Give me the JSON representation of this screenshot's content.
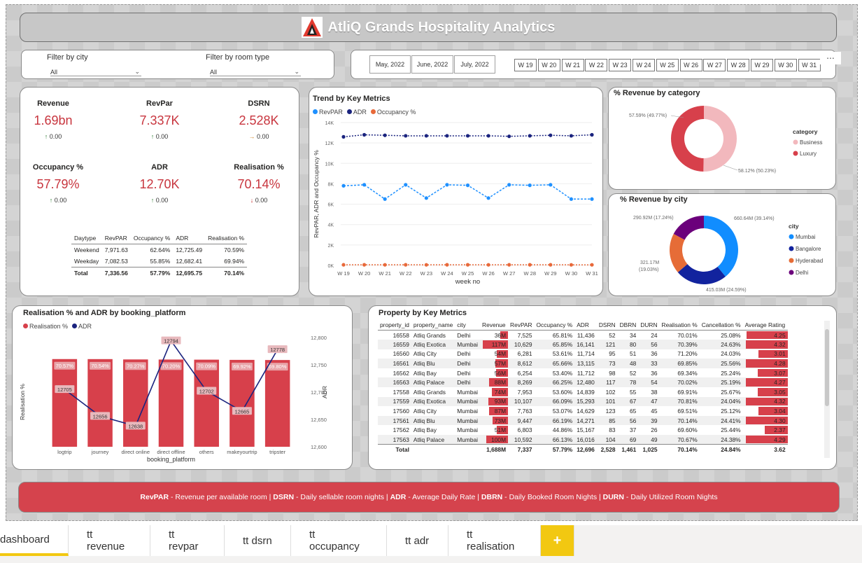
{
  "title": "AtliQ Grands Hospitality Analytics",
  "filters": {
    "city": {
      "label": "Filter by city",
      "value": "All"
    },
    "room_type": {
      "label": "Filter by room type",
      "value": "All"
    },
    "months": [
      "May, 2022",
      "June, 2022",
      "July, 2022"
    ],
    "weeks": [
      "W 19",
      "W 20",
      "W 21",
      "W 22",
      "W 23",
      "W 24",
      "W 25",
      "W 26",
      "W 27",
      "W 28",
      "W 29",
      "W 30",
      "W 31"
    ],
    "more": "..."
  },
  "kpis": [
    {
      "label": "Revenue",
      "value": "1.69bn",
      "change": "0.00",
      "icon": "arrow-up-icon"
    },
    {
      "label": "RevPar",
      "value": "7.337K",
      "change": "0.00",
      "icon": "arrow-up-icon"
    },
    {
      "label": "DSRN",
      "value": "2.528K",
      "change": "0.00",
      "icon": "arrow-right-icon"
    },
    {
      "label": "Occupancy %",
      "value": "57.79%",
      "change": "0.00",
      "icon": "arrow-up-icon"
    },
    {
      "label": "ADR",
      "value": "12.70K",
      "change": "0.00",
      "icon": "arrow-up-icon"
    },
    {
      "label": "Realisation %",
      "value": "70.14%",
      "change": "0.00",
      "icon": "arrow-down-icon"
    }
  ],
  "daytype_table": {
    "headers": [
      "Daytype",
      "RevPAR",
      "Occupancy %",
      "ADR",
      "Realisation %"
    ],
    "rows": [
      [
        "Weekend",
        "7,971.63",
        "62.64%",
        "12,725.49",
        "70.59%"
      ],
      [
        "Weekday",
        "7,082.53",
        "55.85%",
        "12,682.41",
        "69.94%"
      ]
    ],
    "total": [
      "Total",
      "7,336.56",
      "57.79%",
      "12,695.75",
      "70.14%"
    ]
  },
  "chart_data": [
    {
      "type": "line",
      "title": "Trend by Key Metrics",
      "xlabel": "week no",
      "ylabel": "RevPAR, ADR and Occupancy %",
      "x": [
        "W 19",
        "W 20",
        "W 21",
        "W 22",
        "W 23",
        "W 24",
        "W 25",
        "W 26",
        "W 27",
        "W 28",
        "W 29",
        "W 30",
        "W 31"
      ],
      "y_ticks": [
        "0K",
        "2K",
        "4K",
        "6K",
        "8K",
        "10K",
        "12K",
        "14K"
      ],
      "ylim": [
        0,
        14000
      ],
      "series": [
        {
          "name": "RevPAR",
          "color": "#1e90ff",
          "values": [
            7800,
            7900,
            6500,
            7900,
            6600,
            7900,
            7850,
            6600,
            7900,
            7850,
            7900,
            6500,
            6500
          ]
        },
        {
          "name": "ADR",
          "color": "#1a237e",
          "values": [
            12600,
            12800,
            12750,
            12700,
            12700,
            12700,
            12700,
            12700,
            12650,
            12700,
            12750,
            12700,
            12800
          ]
        },
        {
          "name": "Occupancy %",
          "color": "#e8693a",
          "values": [
            58,
            60,
            55,
            60,
            55,
            60,
            59,
            55,
            60,
            59,
            60,
            55,
            55
          ]
        }
      ]
    },
    {
      "type": "pie",
      "title": "% Revenue by category",
      "legend_title": "category",
      "slices": [
        {
          "name": "Business",
          "value": 50.23,
          "color": "#f2b8bd",
          "label": "58.12% (50.23%)"
        },
        {
          "name": "Luxury",
          "value": 49.77,
          "color": "#d7404b",
          "label": "57.59% (49.77%)"
        }
      ]
    },
    {
      "type": "pie",
      "title": "% Revenue by city",
      "legend_title": "city",
      "slices": [
        {
          "name": "Mumbai",
          "value": 39.14,
          "color": "#118dff",
          "label": "660.64M (39.14%)"
        },
        {
          "name": "Bangalore",
          "value": 24.59,
          "color": "#12239e",
          "label": "415.03M (24.59%)"
        },
        {
          "name": "Hyderabad",
          "value": 19.03,
          "color": "#e66c37",
          "label": "321.17M (19.03%)"
        },
        {
          "name": "Delhi",
          "value": 17.24,
          "color": "#6b007b",
          "label": "290.92M (17.24%)"
        }
      ]
    },
    {
      "type": "bar",
      "title": "Realisation % and ADR by booking_platform",
      "xlabel": "booking_platform",
      "ylabel": "Realisation %",
      "y2label": "ADR",
      "categories": [
        "logtrip",
        "journey",
        "direct online",
        "direct offline",
        "others",
        "makeyourtrip",
        "tripster"
      ],
      "y2_ticks": [
        "12,600",
        "12,650",
        "12,700",
        "12,750",
        "12,800"
      ],
      "y2lim": [
        12600,
        12800
      ],
      "series": [
        {
          "name": "Realisation %",
          "color": "#d7404b",
          "values": [
            70.57,
            70.54,
            70.27,
            70.2,
            70.09,
            69.92,
            69.8
          ],
          "labels": [
            "70.57%",
            "70.54%",
            "70.27%",
            "70.20%",
            "70.09%",
            "69.92%",
            "69.80%"
          ]
        },
        {
          "name": "ADR",
          "color": "#1a237e",
          "values": [
            12705,
            12656,
            12638,
            12794,
            12702,
            12665,
            12778
          ],
          "labels": [
            "12705",
            "12656",
            "12638",
            "12794",
            "12702",
            "12665",
            "12778"
          ]
        }
      ]
    }
  ],
  "property_table": {
    "title": "Property by Key Metrics",
    "headers": [
      "property_id",
      "property_name",
      "city",
      "Revenue",
      "RevPAR",
      "Occupancy %",
      "ADR",
      "DSRN",
      "DBRN",
      "DURN",
      "Realisation %",
      "Cancellation %",
      "Average Rating"
    ],
    "rows": [
      [
        "16558",
        "Atliq Grands",
        "Delhi",
        "36M",
        "7,525",
        "65.81%",
        "11,436",
        "52",
        "34",
        "24",
        "70.01%",
        "25.08%",
        "4.25"
      ],
      [
        "16559",
        "Atliq Exotica",
        "Mumbai",
        "117M",
        "10,629",
        "65.85%",
        "16,141",
        "121",
        "80",
        "56",
        "70.39%",
        "24.63%",
        "4.32"
      ],
      [
        "16560",
        "Atliq City",
        "Delhi",
        "54M",
        "6,281",
        "53.61%",
        "11,714",
        "95",
        "51",
        "36",
        "71.20%",
        "24.03%",
        "3.01"
      ],
      [
        "16561",
        "Atliq Blu",
        "Delhi",
        "57M",
        "8,612",
        "65.66%",
        "13,115",
        "73",
        "48",
        "33",
        "69.85%",
        "25.56%",
        "4.28"
      ],
      [
        "16562",
        "Atliq Bay",
        "Delhi",
        "56M",
        "6,254",
        "53.40%",
        "11,712",
        "98",
        "52",
        "36",
        "69.34%",
        "25.24%",
        "3.07"
      ],
      [
        "16563",
        "Atliq Palace",
        "Delhi",
        "88M",
        "8,269",
        "66.25%",
        "12,480",
        "117",
        "78",
        "54",
        "70.02%",
        "25.19%",
        "4.27"
      ],
      [
        "17558",
        "Atliq Grands",
        "Mumbai",
        "74M",
        "7,953",
        "53.60%",
        "14,839",
        "102",
        "55",
        "38",
        "69.91%",
        "25.67%",
        "3.05"
      ],
      [
        "17559",
        "Atliq Exotica",
        "Mumbai",
        "93M",
        "10,107",
        "66.09%",
        "15,293",
        "101",
        "67",
        "47",
        "70.81%",
        "24.04%",
        "4.32"
      ],
      [
        "17560",
        "Atliq City",
        "Mumbai",
        "87M",
        "7,763",
        "53.07%",
        "14,629",
        "123",
        "65",
        "45",
        "69.51%",
        "25.12%",
        "3.04"
      ],
      [
        "17561",
        "Atliq Blu",
        "Mumbai",
        "73M",
        "9,447",
        "66.19%",
        "14,271",
        "85",
        "56",
        "39",
        "70.14%",
        "24.41%",
        "4.30"
      ],
      [
        "17562",
        "Atliq Bay",
        "Mumbai",
        "51M",
        "6,803",
        "44.86%",
        "15,167",
        "83",
        "37",
        "26",
        "69.60%",
        "25.44%",
        "2.37"
      ],
      [
        "17563",
        "Atliq Palace",
        "Mumbai",
        "100M",
        "10,592",
        "66.13%",
        "16,016",
        "104",
        "69",
        "49",
        "70.67%",
        "24.38%",
        "4.29"
      ]
    ],
    "revenue_fill": [
      0.31,
      1.0,
      0.46,
      0.49,
      0.48,
      0.75,
      0.63,
      0.79,
      0.74,
      0.62,
      0.44,
      0.85
    ],
    "rating_fill": [
      0.98,
      1.0,
      0.7,
      0.99,
      0.71,
      0.99,
      0.71,
      1.0,
      0.7,
      1.0,
      0.55,
      0.99
    ],
    "total": [
      "Total",
      "",
      "",
      "1,688M",
      "7,337",
      "57.79%",
      "12,696",
      "2,528",
      "1,461",
      "1,025",
      "70.14%",
      "24.84%",
      "3.62"
    ]
  },
  "footer": {
    "parts": [
      {
        "term": "RevPAR",
        "desc": " - Revenue per available room | "
      },
      {
        "term": "DSRN",
        "desc": " - Daily sellable room nights | "
      },
      {
        "term": "ADR",
        "desc": " - Average Daily Rate | "
      },
      {
        "term": "DBRN",
        "desc": " - Daily Booked Room Nights | "
      },
      {
        "term": "DURN",
        "desc": " - Daily Utilized Room Nights"
      }
    ]
  },
  "tabs": [
    "dashboard",
    "tt revenue",
    "tt revpar",
    "tt dsrn",
    "tt occupancy",
    "tt adr",
    "tt realisation"
  ],
  "add_tab": "+",
  "colors": {
    "accent": "#d7404b",
    "tab_accent": "#f2c811"
  }
}
